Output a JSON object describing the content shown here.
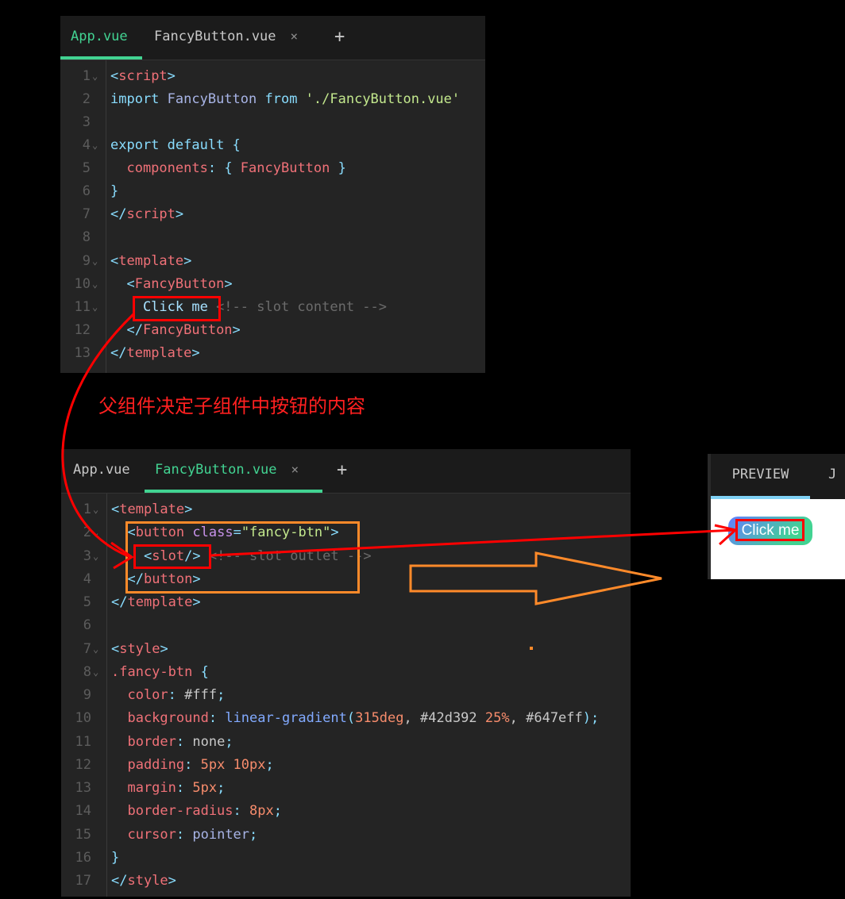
{
  "top_editor": {
    "tabs": [
      {
        "label": "App.vue",
        "active": true
      },
      {
        "label": "FancyButton.vue",
        "active": false,
        "close": "×"
      }
    ],
    "add_tab": "+",
    "lines": [
      {
        "n": "1",
        "fold": true
      },
      {
        "n": "2"
      },
      {
        "n": "3"
      },
      {
        "n": "4",
        "fold": true
      },
      {
        "n": "5"
      },
      {
        "n": "6"
      },
      {
        "n": "7"
      },
      {
        "n": "8"
      },
      {
        "n": "9",
        "fold": true
      },
      {
        "n": "10",
        "fold": true
      },
      {
        "n": "11",
        "fold": true
      },
      {
        "n": "12"
      },
      {
        "n": "13"
      }
    ],
    "code": {
      "l1": [
        "<",
        "script",
        ">"
      ],
      "l2": [
        "import",
        " FancyButton ",
        "from",
        " './FancyButton.vue'"
      ],
      "l4": [
        "export",
        " default",
        " {"
      ],
      "l5": [
        "  components",
        ":",
        " {",
        " FancyButton",
        " }"
      ],
      "l6": [
        "}"
      ],
      "l7": [
        "</",
        "script",
        ">"
      ],
      "l9": [
        "<",
        "template",
        ">"
      ],
      "l10": [
        "  <",
        "FancyButton",
        ">"
      ],
      "l11": [
        "    Click me",
        " <!-- slot content -->"
      ],
      "l12": [
        "  </",
        "FancyButton",
        ">"
      ],
      "l13": [
        "</",
        "template",
        ">"
      ]
    }
  },
  "caption": "父组件决定子组件中按钮的内容",
  "bottom_editor": {
    "tabs": [
      {
        "label": "App.vue",
        "active": false
      },
      {
        "label": "FancyButton.vue",
        "active": true,
        "close": "×"
      }
    ],
    "add_tab": "+",
    "lines": [
      {
        "n": "1",
        "fold": true
      },
      {
        "n": "2",
        "fold": true
      },
      {
        "n": "3",
        "fold": true
      },
      {
        "n": "4"
      },
      {
        "n": "5"
      },
      {
        "n": "6"
      },
      {
        "n": "7",
        "fold": true
      },
      {
        "n": "8",
        "fold": true
      },
      {
        "n": "9"
      },
      {
        "n": "10"
      },
      {
        "n": "11"
      },
      {
        "n": "12"
      },
      {
        "n": "13"
      },
      {
        "n": "14"
      },
      {
        "n": "15"
      },
      {
        "n": "16"
      },
      {
        "n": "17"
      }
    ],
    "code": {
      "l1": [
        "<",
        "template",
        ">"
      ],
      "l2": [
        "  <",
        "button",
        " class",
        "=",
        "\"fancy-btn\"",
        ">"
      ],
      "l3": [
        "    <",
        "slot",
        "/>",
        " <!-- slot outlet -->"
      ],
      "l4": [
        "  </",
        "button",
        ">"
      ],
      "l5": [
        "</",
        "template",
        ">"
      ],
      "l7": [
        "<",
        "style",
        ">"
      ],
      "l8": [
        ".fancy-btn",
        " {"
      ],
      "l9": [
        "  color",
        ": ",
        "#fff",
        ";"
      ],
      "l10": [
        "  background",
        ": ",
        "linear-gradient",
        "(",
        "315deg",
        ", ",
        "#42d392",
        " ",
        "25%",
        ", ",
        "#647eff",
        ");"
      ],
      "l11": [
        "  border",
        ": ",
        "none",
        ";"
      ],
      "l12": [
        "  padding",
        ": ",
        "5px 10px",
        ";"
      ],
      "l13": [
        "  margin",
        ": ",
        "5px",
        ";"
      ],
      "l14": [
        "  border-radius",
        ": ",
        "8px",
        ";"
      ],
      "l15": [
        "  cursor",
        ": ",
        "pointer",
        ";"
      ],
      "l16": [
        "}"
      ],
      "l17": [
        "</",
        "style",
        ">"
      ]
    }
  },
  "preview": {
    "tab_label": "PREVIEW",
    "tab2_label": "J",
    "button_label": "Click me"
  },
  "colors": {
    "accent_green": "#42d392",
    "gradient_blue": "#647eff",
    "annotation_red": "#ff0000",
    "annotation_orange": "#ff8a2a"
  }
}
